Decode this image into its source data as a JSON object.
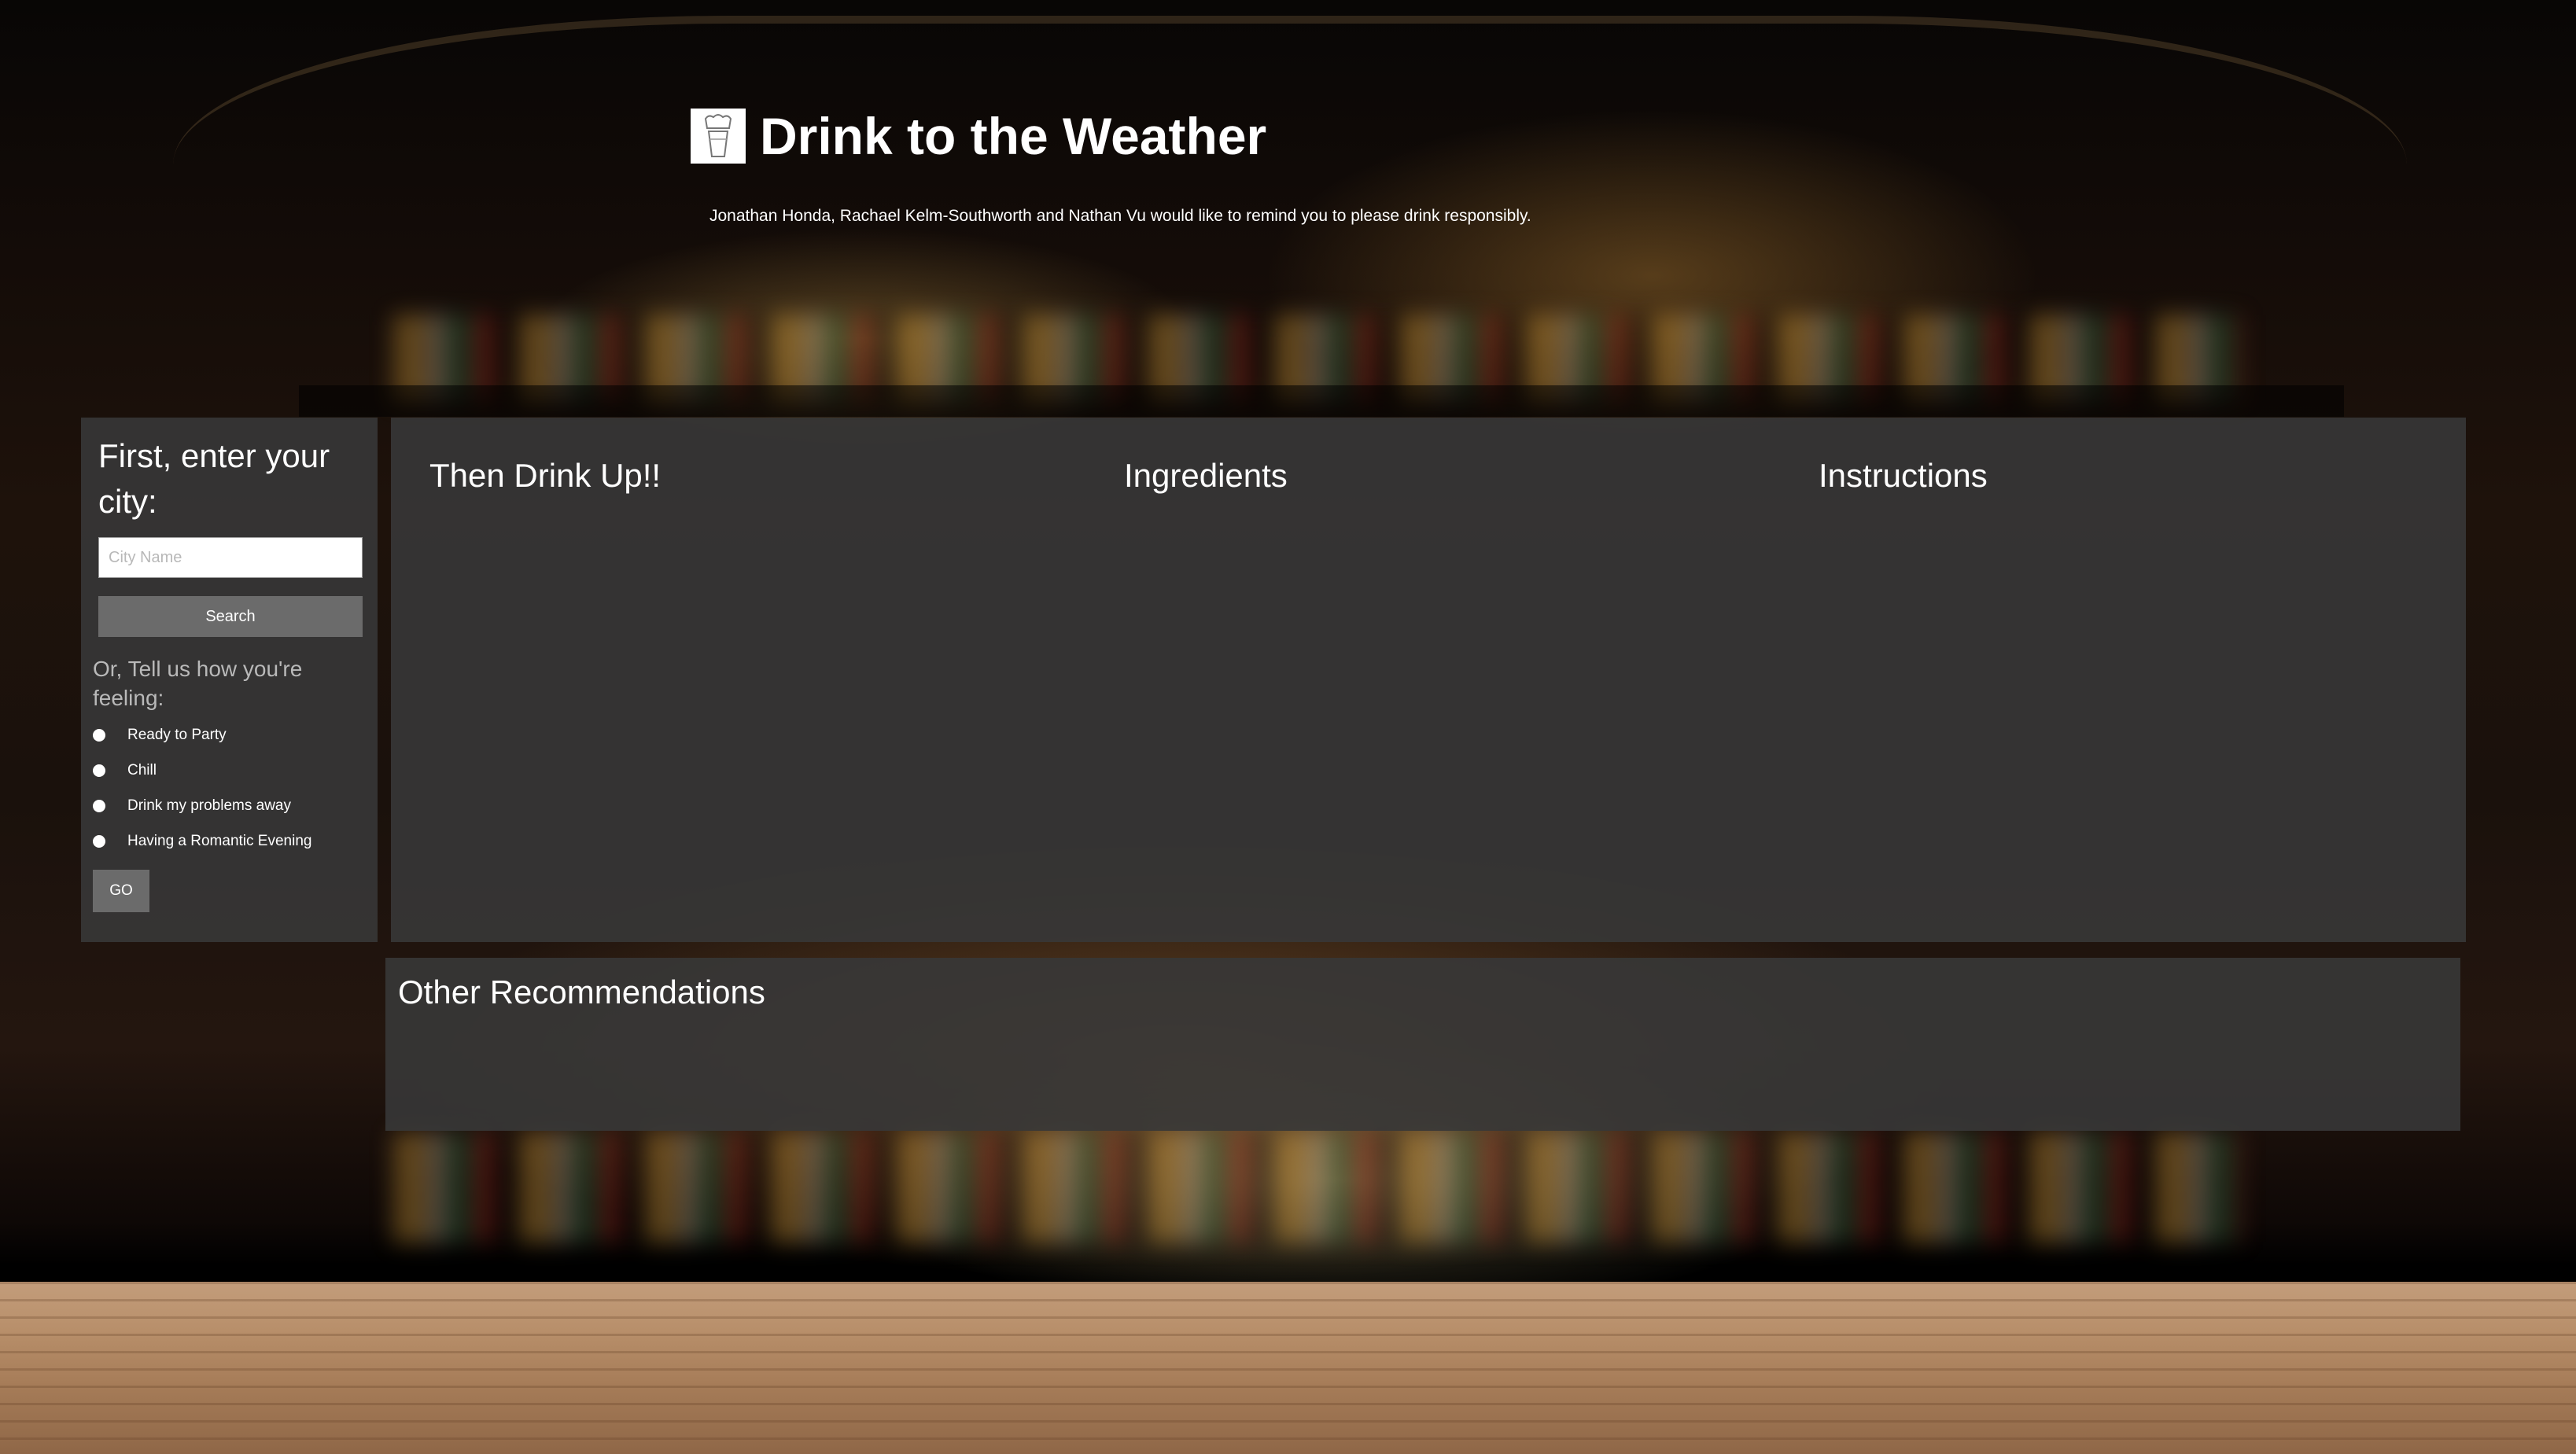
{
  "header": {
    "title": "Drink to the Weather",
    "subtitle": "Jonathan Honda, Rachael Kelm-Southworth and Nathan Vu would like to remind you to please drink responsibly.",
    "logo_icon": "cocktail-glass-icon"
  },
  "city_search": {
    "heading": "First, enter your city:",
    "input_placeholder": "City Name",
    "input_value": "",
    "search_label": "Search"
  },
  "mood": {
    "heading": "Or, Tell us how you're feeling:",
    "options": [
      {
        "label": "Ready to Party",
        "selected": false
      },
      {
        "label": "Chill",
        "selected": false
      },
      {
        "label": "Drink my problems away",
        "selected": false
      },
      {
        "label": "Having a Romantic Evening",
        "selected": false
      }
    ],
    "go_label": "GO"
  },
  "results": {
    "drink_heading": "Then Drink Up!!",
    "ingredients_heading": "Ingredients",
    "instructions_heading": "Instructions"
  },
  "other": {
    "heading": "Other Recommendations"
  },
  "colors": {
    "panel_bg": "#373737",
    "button_bg": "#6b6b6b",
    "muted_text": "#b9b9b9"
  }
}
